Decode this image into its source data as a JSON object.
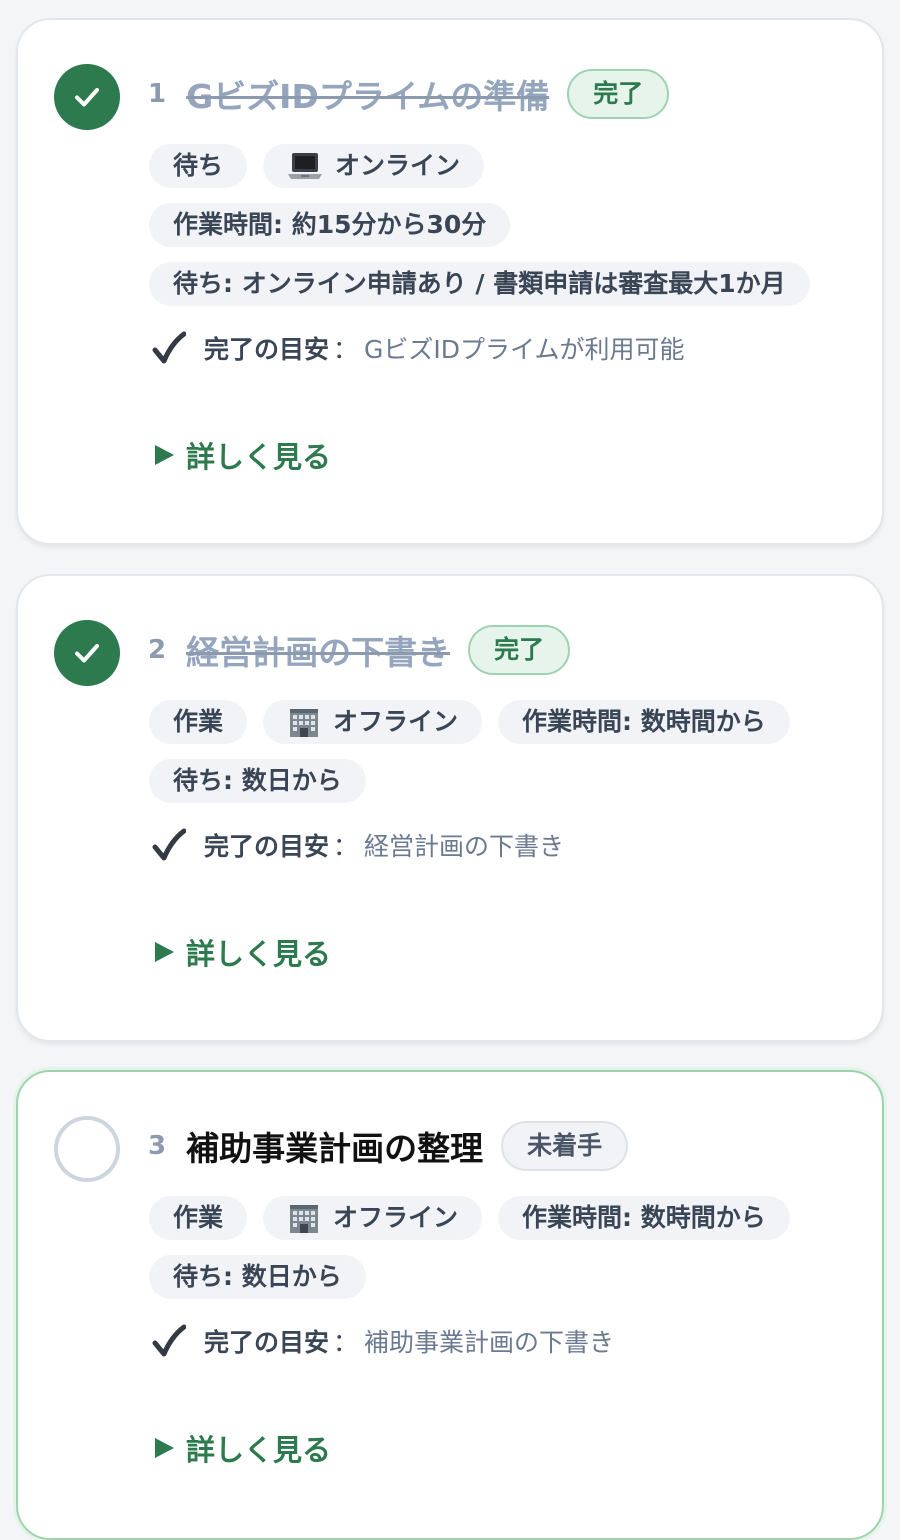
{
  "steps": [
    {
      "number": "1",
      "title": "GビズIDプライムの準備",
      "badge": "完了",
      "chips": [
        "待ち",
        "オンライン",
        "作業時間: 約15分から30分",
        "待ち: オンライン申請あり / 書類申請は審査最大1か月"
      ],
      "criteria_label": "完了の目安",
      "criteria_sep": "：",
      "criteria_value": "GビズIDプライムが利用可能",
      "details_label": "詳しく見る"
    },
    {
      "number": "2",
      "title": "経営計画の下書き",
      "badge": "完了",
      "chips": [
        "作業",
        "オフライン",
        "作業時間: 数時間から",
        "待ち: 数日から"
      ],
      "criteria_label": "完了の目安",
      "criteria_sep": "：",
      "criteria_value": "経営計画の下書き",
      "details_label": "詳しく見る"
    },
    {
      "number": "3",
      "title": "補助事業計画の整理",
      "badge": "未着手",
      "chips": [
        "作業",
        "オフライン",
        "作業時間: 数時間から",
        "待ち: 数日から"
      ],
      "criteria_label": "完了の目安",
      "criteria_sep": "：",
      "criteria_value": "補助事業計画の下書き",
      "details_label": "詳しく見る"
    }
  ],
  "icons": {
    "online": "laptop-icon",
    "offline": "office-building-icon",
    "done": "checkmark-icon",
    "criteria": "heavy-check-icon",
    "details": "triangle-right-icon"
  },
  "colors": {
    "accent_green": "#2c7a4d",
    "done_title": "#95a5bd",
    "chip_bg": "#f1f3f6",
    "active_border": "#9fd3ae"
  }
}
